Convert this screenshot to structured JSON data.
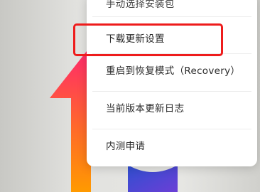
{
  "menu": {
    "items": [
      {
        "label": "手动选择安装包"
      },
      {
        "label": "下载更新设置"
      },
      {
        "label": "重启到恢复模式（Recovery）"
      },
      {
        "label": "当前版本更新日志"
      },
      {
        "label": "内测申请"
      }
    ],
    "highlighted_index": 1
  },
  "colors": {
    "highlight": "#ee1c1c",
    "logo_gradient": [
      "#ff2a6a",
      "#ff6a2a",
      "#ff9a00"
    ],
    "logo_circle": "#3f5bd9"
  },
  "icons": {
    "update_logo": "system-update-arrow-icon"
  }
}
